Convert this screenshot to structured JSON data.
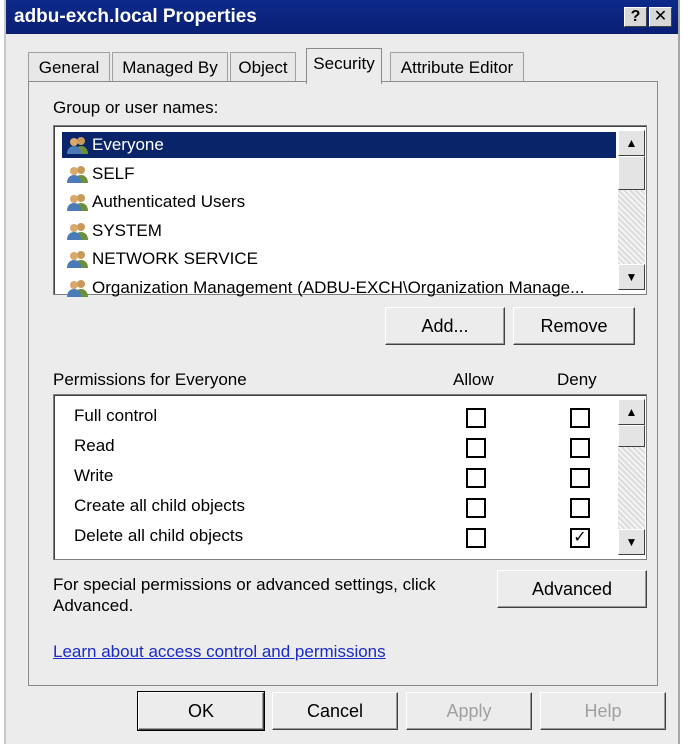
{
  "window": {
    "title": "adbu-exch.local Properties",
    "help_glyph": "?",
    "close_glyph": "✕"
  },
  "tabs": [
    {
      "label": "General",
      "active": false
    },
    {
      "label": "Managed By",
      "active": false
    },
    {
      "label": "Object",
      "active": false
    },
    {
      "label": "Security",
      "active": true
    },
    {
      "label": "Attribute Editor",
      "active": false
    }
  ],
  "groups": {
    "label": "Group or user names:",
    "items": [
      {
        "name": "Everyone",
        "selected": true
      },
      {
        "name": "SELF",
        "selected": false
      },
      {
        "name": "Authenticated Users",
        "selected": false
      },
      {
        "name": "SYSTEM",
        "selected": false
      },
      {
        "name": "NETWORK SERVICE",
        "selected": false
      },
      {
        "name": "Organization Management (ADBU-EXCH\\Organization Manage...",
        "selected": false
      }
    ],
    "add_label": "Add...",
    "remove_label": "Remove"
  },
  "permissions": {
    "label": "Permissions for Everyone",
    "allow_header": "Allow",
    "deny_header": "Deny",
    "rows": [
      {
        "name": "Full control",
        "allow": false,
        "deny": false
      },
      {
        "name": "Read",
        "allow": false,
        "deny": false
      },
      {
        "name": "Write",
        "allow": false,
        "deny": false
      },
      {
        "name": "Create all child objects",
        "allow": false,
        "deny": false
      },
      {
        "name": "Delete all child objects",
        "allow": false,
        "deny": true
      }
    ]
  },
  "advanced": {
    "text": "For special permissions or advanced settings, click Advanced.",
    "button_label": "Advanced"
  },
  "learn_link": "Learn about access control and permissions",
  "footer": {
    "ok": "OK",
    "cancel": "Cancel",
    "apply": "Apply",
    "help": "Help"
  },
  "scroll_glyphs": {
    "up": "▲",
    "down": "▼"
  },
  "check_glyph": "✓",
  "colors": {
    "title_bar": "#0a1f74",
    "selection": "#0a246a",
    "link": "#1a2bc8"
  }
}
